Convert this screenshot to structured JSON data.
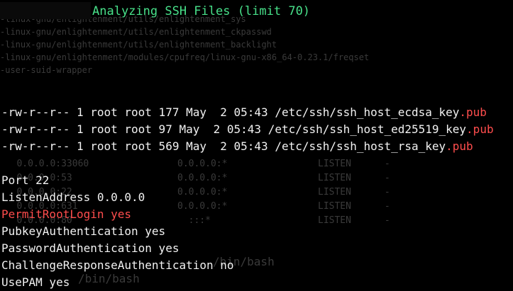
{
  "header": {
    "title": "Analyzing SSH Files (limit 70)"
  },
  "ghost": {
    "top": "-linux-gnu/enlightenment/utils/enlightenment_sys\n-linux-gnu/enlightenment/utils/enlightenment_ckpasswd\n-linux-gnu/enlightenment/utils/enlightenment_backlight\n-linux-gnu/enlightenment/modules/cpufreq/linux-gnu-x86_64-0.23.1/freqset\n-user-suid-wrapper",
    "mid_left": "   0.0.0.0:33060\n   0.0.0.0:53\n   0.0.0.0:22\n   0.0.0.0:631\n   0.0.0.0:80",
    "mid_right": "0.0.0.0:*\n0.0.0.0:*\n0.0.0.0:*\n0.0.0.0:*\n  :::*",
    "mid_far": "LISTEN      -\nLISTEN      -\nLISTEN      -\nLISTEN      -\nLISTEN      -",
    "bottom_a": "/bin/bash",
    "bottom_b": "/bin/bash"
  },
  "files": [
    {
      "meta": "-rw-r--r-- 1 root root 177 May  2 05:43 ",
      "path": "/etc/ssh/ssh_host_ecdsa_key",
      "ext": ".pub"
    },
    {
      "meta": "-rw-r--r-- 1 root root 97 May  2 05:43 ",
      "path": "/etc/ssh/ssh_host_ed25519_key",
      "ext": ".pub"
    },
    {
      "meta": "-rw-r--r-- 1 root root 569 May  2 05:43 ",
      "path": "/etc/ssh/ssh_host_rsa_key",
      "ext": ".pub"
    }
  ],
  "config": [
    {
      "text": "Port 22",
      "highlight": false
    },
    {
      "text": "ListenAddress 0.0.0.0",
      "highlight": false
    },
    {
      "text": "PermitRootLogin yes",
      "highlight": true
    },
    {
      "text": "PubkeyAuthentication yes",
      "highlight": false
    },
    {
      "text": "PasswordAuthentication yes",
      "highlight": false
    },
    {
      "text": "ChallengeResponseAuthentication no",
      "highlight": false
    },
    {
      "text": "UsePAM yes",
      "highlight": false
    }
  ],
  "colors": {
    "background": "#000000",
    "header_text": "#48e18a",
    "highlight": "#ff4d4d",
    "text": "#f2f2f2"
  }
}
